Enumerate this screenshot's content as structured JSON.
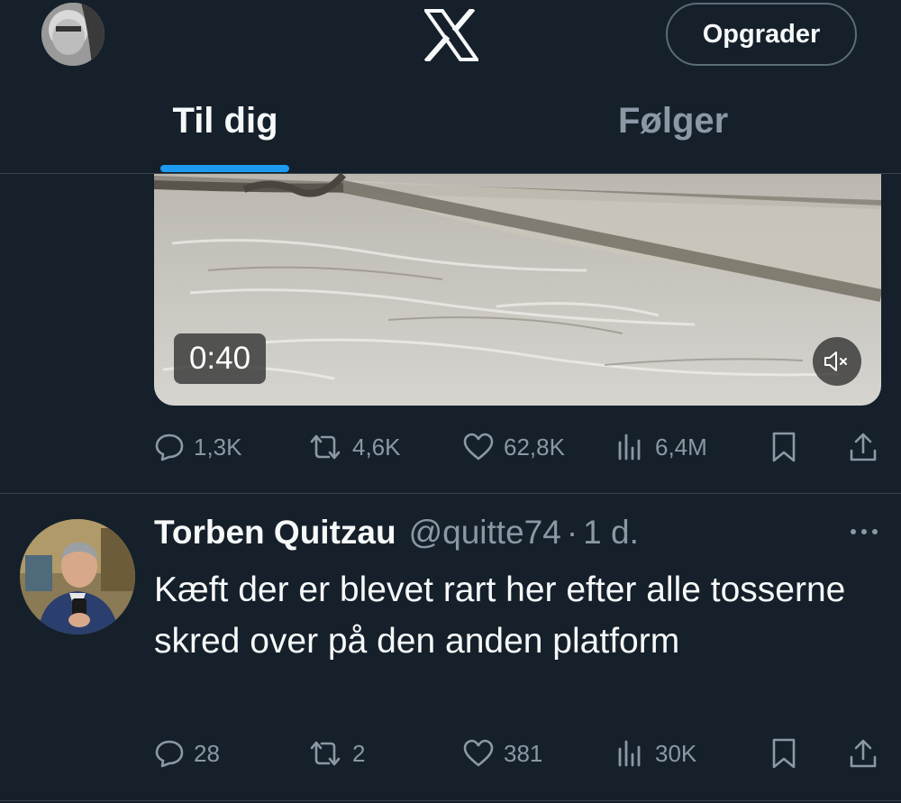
{
  "header": {
    "upgrade_label": "Opgrader",
    "tabs": [
      {
        "label": "Til dig",
        "active": true
      },
      {
        "label": "Følger",
        "active": false
      }
    ]
  },
  "video": {
    "duration": "0:40"
  },
  "tweet1_actions": {
    "replies": "1,3K",
    "reposts": "4,6K",
    "likes": "62,8K",
    "views": "6,4M"
  },
  "tweet2": {
    "name": "Torben Quitzau",
    "handle": "@quitte74",
    "separator": "·",
    "time": "1 d.",
    "text": "Kæft der er blevet rart her efter alle tosserne skred over på den anden platform",
    "actions": {
      "replies": "28",
      "reposts": "2",
      "likes": "381",
      "views": "30K"
    }
  },
  "colors": {
    "background": "#15202b",
    "accent": "#1d9bf0",
    "muted_text": "#8b98a5",
    "divider": "#38444d"
  }
}
